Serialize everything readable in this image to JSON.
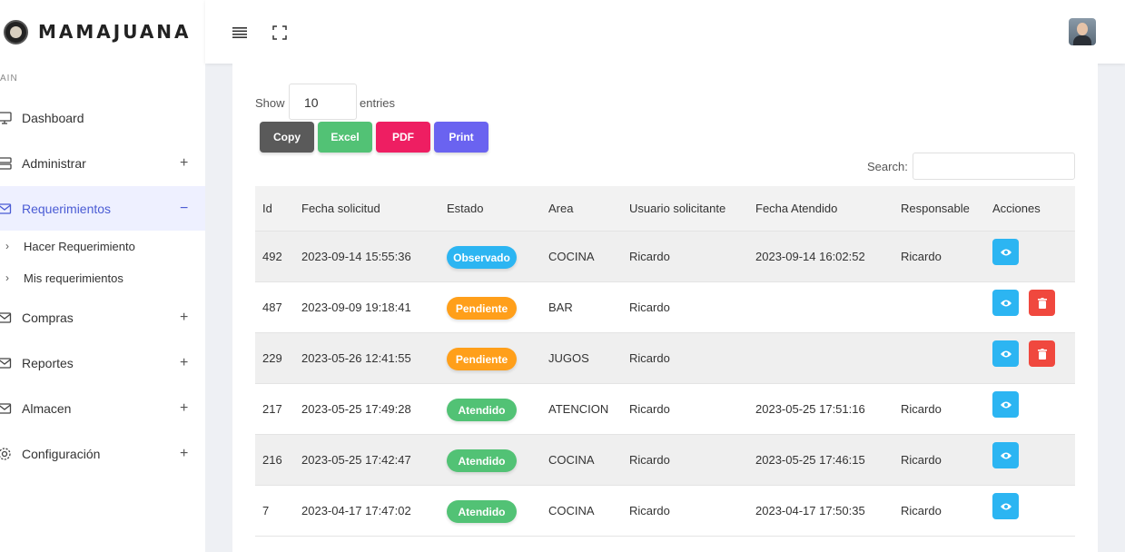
{
  "brand": {
    "name": "MAMAJUANA"
  },
  "sidebar": {
    "section": "AIN",
    "items": [
      {
        "label": "Dashboard",
        "icon": "monitor-icon",
        "expander": ""
      },
      {
        "label": "Administrar",
        "icon": "server-icon",
        "expander": "+"
      },
      {
        "label": "Requerimientos",
        "icon": "mail-icon",
        "expander": "−"
      },
      {
        "label": "Compras",
        "icon": "mail-icon",
        "expander": "+"
      },
      {
        "label": "Reportes",
        "icon": "mail-icon",
        "expander": "+"
      },
      {
        "label": "Almacen",
        "icon": "mail-icon",
        "expander": "+"
      },
      {
        "label": "Configuración",
        "icon": "gear-icon",
        "expander": "+"
      }
    ],
    "subitems": [
      {
        "label": "Hacer Requerimiento",
        "chev": "›"
      },
      {
        "label": "Mis requerimientos",
        "chev": "›"
      }
    ]
  },
  "controls": {
    "show_label": "Show",
    "entries_value": "10",
    "entries_label": "entries",
    "search_label": "Search:"
  },
  "buttons": {
    "copy": "Copy",
    "excel": "Excel",
    "pdf": "PDF",
    "print": "Print"
  },
  "table": {
    "headers": [
      "Id",
      "Fecha solicitud",
      "Estado",
      "Area",
      "Usuario solicitante",
      "Fecha Atendido",
      "Responsable",
      "Acciones"
    ],
    "rows": [
      {
        "id": "492",
        "fecha": "2023-09-14 15:55:36",
        "estado": "Observado",
        "area": "COCINA",
        "usuario": "Ricardo",
        "atendido": "2023-09-14 16:02:52",
        "responsable": "Ricardo",
        "deletable": false
      },
      {
        "id": "487",
        "fecha": "2023-09-09 19:18:41",
        "estado": "Pendiente",
        "area": "BAR",
        "usuario": "Ricardo",
        "atendido": "",
        "responsable": "",
        "deletable": true
      },
      {
        "id": "229",
        "fecha": "2023-05-26 12:41:55",
        "estado": "Pendiente",
        "area": "JUGOS",
        "usuario": "Ricardo",
        "atendido": "",
        "responsable": "",
        "deletable": true
      },
      {
        "id": "217",
        "fecha": "2023-05-25 17:49:28",
        "estado": "Atendido",
        "area": "ATENCION",
        "usuario": "Ricardo",
        "atendido": "2023-05-25 17:51:16",
        "responsable": "Ricardo",
        "deletable": false
      },
      {
        "id": "216",
        "fecha": "2023-05-25 17:42:47",
        "estado": "Atendido",
        "area": "COCINA",
        "usuario": "Ricardo",
        "atendido": "2023-05-25 17:46:15",
        "responsable": "Ricardo",
        "deletable": false
      },
      {
        "id": "7",
        "fecha": "2023-04-17 17:47:02",
        "estado": "Atendido",
        "area": "COCINA",
        "usuario": "Ricardo",
        "atendido": "2023-04-17 17:50:35",
        "responsable": "Ricardo",
        "deletable": false
      }
    ]
  },
  "colors": {
    "Observado": "#2cb5f2",
    "Pendiente": "#ff9f1a",
    "Atendido": "#52c275",
    "accent": "#4a5bd4"
  }
}
